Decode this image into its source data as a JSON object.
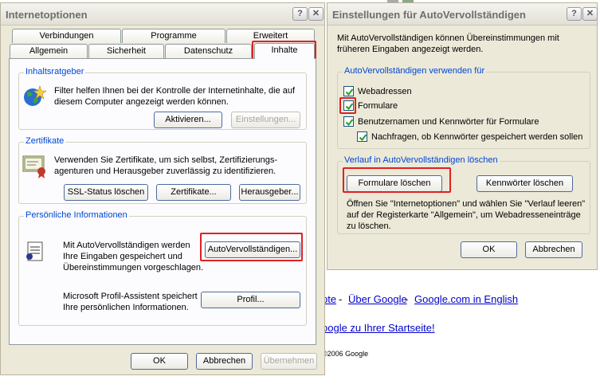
{
  "internet_options": {
    "title": "Internetoptionen",
    "help_glyph": "?",
    "close_glyph": "✕",
    "tabs_row1": [
      "Verbindungen",
      "Programme",
      "Erweitert"
    ],
    "tabs_row2": [
      "Allgemein",
      "Sicherheit",
      "Datenschutz",
      "Inhalte"
    ],
    "content_advisor": {
      "legend": "Inhaltsratgeber",
      "text": "Filter helfen Ihnen bei der Kontrolle der Internetinhalte, die auf diesem Computer angezeigt werden können.",
      "activate_label": "Aktivieren...",
      "settings_label": "Einstellungen..."
    },
    "certificates": {
      "legend": "Zertifikate",
      "text": "Verwenden Sie Zertifikate, um sich selbst, Zertifizierungs-agenturen und Herausgeber zuverlässig zu identifizieren.",
      "ssl_label": "SSL-Status löschen",
      "certs_label": "Zertifikate...",
      "publishers_label": "Herausgeber..."
    },
    "personal": {
      "legend": "Persönliche Informationen",
      "autocomplete_text": "Mit AutoVervollständigen werden Ihre Eingaben gespeichert und Übereinstimmungen vorgeschlagen.",
      "autocomplete_label": "AutoVervollständigen...",
      "profile_text": "Microsoft Profil-Assistent speichert Ihre persönlichen Informationen.",
      "profile_label": "Profil..."
    },
    "ok_label": "OK",
    "cancel_label": "Abbrechen",
    "apply_label": "Übernehmen"
  },
  "autocomplete_settings": {
    "title": "Einstellungen für AutoVervollständigen",
    "help_glyph": "?",
    "close_glyph": "✕",
    "intro": "Mit AutoVervollständigen können Übereinstimmungen mit früheren Eingaben angezeigt werden.",
    "use_for_legend": "AutoVervollständigen verwenden für",
    "options": [
      {
        "label": "Webadressen",
        "checked": true
      },
      {
        "label": "Formulare",
        "checked": true
      },
      {
        "label": "Benutzernamen und Kennwörter für Formulare",
        "checked": true
      },
      {
        "label": "Nachfragen, ob Kennwörter gespeichert werden sollen",
        "checked": true
      }
    ],
    "history_legend": "Verlauf in AutoVervollständigen löschen",
    "clear_forms_label": "Formulare löschen",
    "clear_passwords_label": "Kennwörter löschen",
    "history_text": "Öffnen Sie \"Internetoptionen\" und wählen Sie \"Verlauf leeren\" auf der Registerkarte \"Allgemein\", um Webadresseneinträge zu löschen.",
    "ok_label": "OK",
    "cancel_label": "Abbrechen"
  },
  "background_page": {
    "link1": "pte",
    "sep1": " - ",
    "link2": "Über Google",
    "sep2": " - ",
    "link3": "Google.com in English",
    "link4": "oogle zu Ihrer Startseite!",
    "copyright": "©2006 Google"
  },
  "colors": {
    "highlight": "#e02020",
    "legend": "#0046d5",
    "dialog_bg": "#ece9d8"
  }
}
